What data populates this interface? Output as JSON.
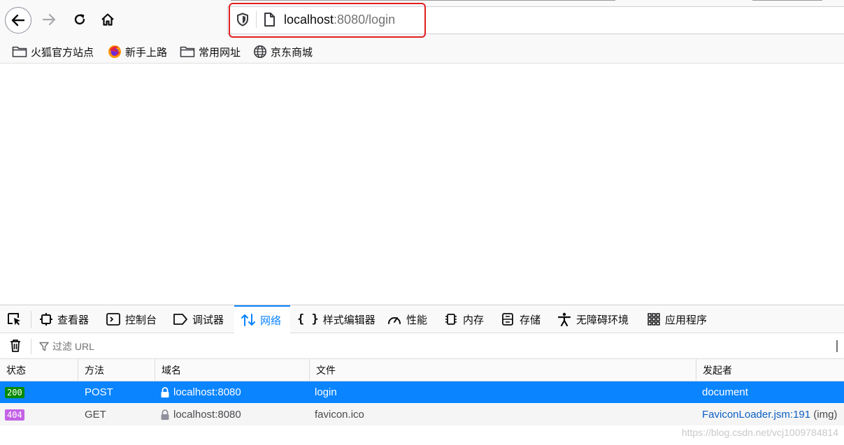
{
  "browser": {
    "url_host": "localhost",
    "url_rest": ":8080/login",
    "accent": "#0a84ff",
    "highlight_color": "#e02020"
  },
  "bookmarks": [
    {
      "label": "火狐官方站点",
      "icon": "folder-icon"
    },
    {
      "label": "新手上路",
      "icon": "firefox-icon"
    },
    {
      "label": "常用网址",
      "icon": "folder-icon"
    },
    {
      "label": "京东商城",
      "icon": "globe-icon"
    }
  ],
  "devtools": {
    "tabs": [
      {
        "label": "",
        "icon": "picker-icon"
      },
      {
        "label": "查看器",
        "icon": "inspector-icon"
      },
      {
        "label": "控制台",
        "icon": "console-icon"
      },
      {
        "label": "调试器",
        "icon": "debugger-icon"
      },
      {
        "label": "网络",
        "icon": "network-icon"
      },
      {
        "label": "样式编辑器",
        "icon": "style-editor-icon"
      },
      {
        "label": "性能",
        "icon": "performance-icon"
      },
      {
        "label": "内存",
        "icon": "memory-icon"
      },
      {
        "label": "存储",
        "icon": "storage-icon"
      },
      {
        "label": "无障碍环境",
        "icon": "accessibility-icon"
      },
      {
        "label": "应用程序",
        "icon": "application-icon"
      }
    ],
    "active_tab": "网络",
    "filter_placeholder": "过滤 URL",
    "columns": [
      "状态",
      "方法",
      "域名",
      "文件",
      "发起者"
    ],
    "rows": [
      {
        "status": "200",
        "status_color": "#058b00",
        "method": "POST",
        "domain": "localhost:8080",
        "file": "login",
        "initiator": "document",
        "initiator_extra": ""
      },
      {
        "status": "404",
        "status_color": "#c462e6",
        "method": "GET",
        "domain": "localhost:8080",
        "file": "favicon.ico",
        "initiator": "FaviconLoader.jsm:191",
        "initiator_extra": " (img)"
      }
    ]
  },
  "watermark": "https://blog.csdn.net/vcj1009784814"
}
